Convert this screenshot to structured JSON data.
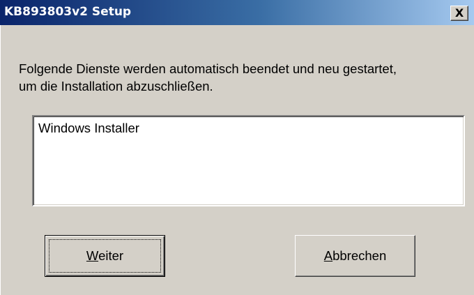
{
  "window": {
    "title": "KB893803v2 Setup",
    "close_glyph": "X"
  },
  "message": {
    "line1": "Folgende Dienste werden automatisch beendet und neu gestartet,",
    "line2": "um die Installation abzuschließen."
  },
  "services": {
    "items": [
      "Windows Installer"
    ]
  },
  "buttons": {
    "next": {
      "mnemonic": "W",
      "rest": "eiter"
    },
    "cancel": {
      "mnemonic": "A",
      "rest": "bbrechen"
    }
  },
  "colors": {
    "titlebar_start": "#0a246a",
    "titlebar_end": "#a6caf0",
    "face": "#d4d0c8"
  }
}
